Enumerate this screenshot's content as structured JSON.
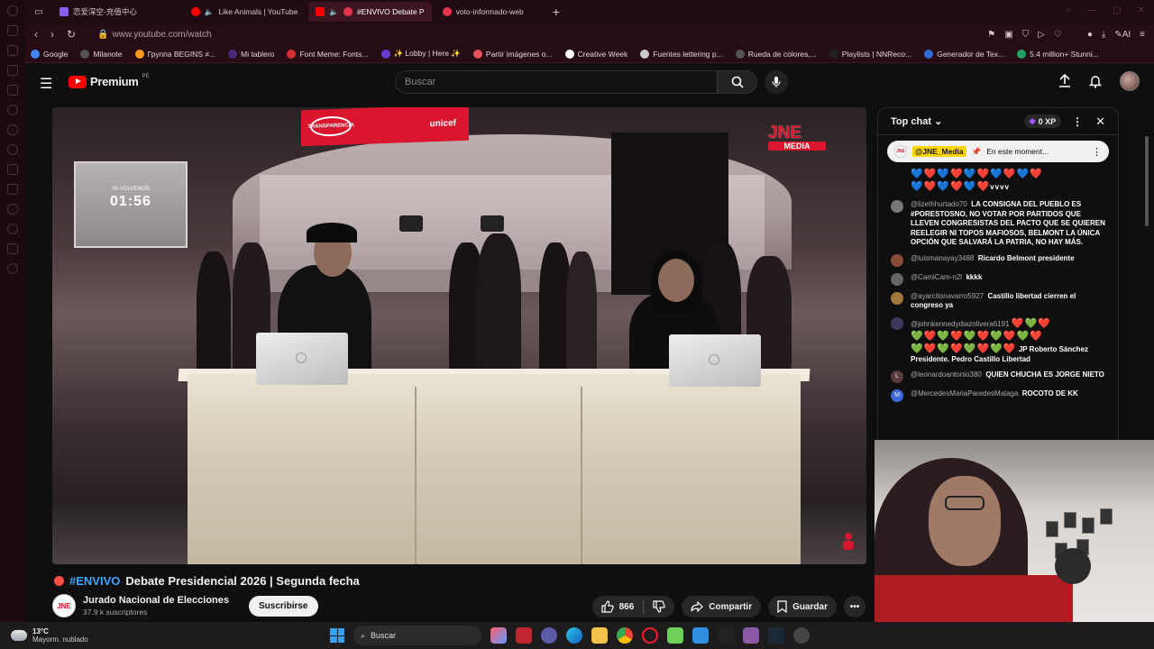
{
  "browser": {
    "tabs": [
      {
        "label": "恋爱深空-充值中心",
        "active": false,
        "color": "#8a5cf6"
      },
      {
        "label": "Like Animals | YouTube",
        "active": false,
        "color": "#ff0000"
      },
      {
        "label": "#ENVIVO Debate P",
        "active": true,
        "color": "#ff0000"
      },
      {
        "label": "voto-informado-web",
        "active": false,
        "color": "#e2354b"
      }
    ],
    "url": "www.youtube.com/watch",
    "bookmarks": [
      {
        "label": "Google",
        "color": "#4285f4"
      },
      {
        "label": "Milanote",
        "color": "#333333"
      },
      {
        "label": "Группа BEGINS ≠...",
        "color": "#f79a1e"
      },
      {
        "label": "Mi tablero",
        "color": "#4b2a7a"
      },
      {
        "label": "Font Meme: Fonts...",
        "color": "#d42e2e"
      },
      {
        "label": "✨ Lobby | Here ✨",
        "color": "#6a3bd1"
      },
      {
        "label": "Partir imágenes o...",
        "color": "#e8525c"
      },
      {
        "label": "Creative Week",
        "color": "#ffffff"
      },
      {
        "label": "Fuentes lettering p...",
        "color": "#cccccc"
      },
      {
        "label": "Rueda de colores,...",
        "color": "#555555"
      },
      {
        "label": "Playlists | NNReco...",
        "color": "#222222"
      },
      {
        "label": "Generador de Tex...",
        "color": "#2f6ad9"
      },
      {
        "label": "5.4 million+ Stunni...",
        "color": "#1fa463"
      }
    ]
  },
  "youtube": {
    "brand": "Premium",
    "country": "PE",
    "search_placeholder": "Buscar",
    "video": {
      "screen_label": "YA VOLVEMOS",
      "countdown": "01:56",
      "banner_text": "unicef",
      "banner_sub": "TRANSPARENCIA",
      "jne_top": "JNE",
      "jne_bottom": "MEDIA"
    },
    "title_tag": "#ENVIVO",
    "title_rest": "Debate Presidencial 2026 | Segunda fecha",
    "channel_name": "Jurado Nacional de Elecciones",
    "channel_avatar": "JNE",
    "subscribers": "37.9 k suscriptores",
    "subscribe_label": "Suscribirse",
    "likes": "866",
    "share_label": "Compartir",
    "save_label": "Guardar"
  },
  "chat": {
    "header": "Top chat",
    "xp": "0 XP",
    "pinned_author": "@JNE_Media",
    "pinned_text": "En este moment...",
    "messages": [
      {
        "user": "",
        "hearts": "💙❤️💙❤️💙❤️💙❤️💙❤️",
        "hearts2": "💙❤️💙❤️💙❤️",
        "text": "vvvv",
        "avatar": "#000000"
      },
      {
        "user": "@lizethhurtado70",
        "text": "LA CONSIGNA DEL PUEBLO ES #PORESTOSNO, NO VOTAR POR PARTIDOS QUE LLEVEN CONGRESISTAS DEL PACTO QUE SE QUIEREN REELEGIR NI TOPOS MAFIOSOS, BELMONT LA ÚNICA OPCIÓN QUE SALVARÁ LA PATRIA, NO HAY MÁS.",
        "avatar": "#777777"
      },
      {
        "user": "@luismanayay3488",
        "text": "Ricardo Belmont presidente",
        "avatar": "#8a4b3a"
      },
      {
        "user": "@CamiCam-n2l",
        "text": "kkkk",
        "avatar": "#666666"
      },
      {
        "user": "@ayarcitonavarro5927",
        "text": "Castillo libertad cierren el congreso ya",
        "avatar": "#a0783c"
      },
      {
        "user": "@johnkennedydiazolivera6191",
        "hearts": "❤️💚❤️",
        "hearts2": "💚❤️💚❤️💚❤️💚❤️💚❤️",
        "hearts3": "💚❤️💚❤️💚❤️💚❤️",
        "text": "JP Roberto Sánchez Presidente. Pedro Castillo Libertad",
        "avatar": "#3a3a5a"
      },
      {
        "user": "@leonardoantonio380",
        "text": "QUIEN CHUCHA ES JORGE NIETO",
        "avatar": "#5a3a3a",
        "initial": "L"
      },
      {
        "user": "@MercedesMariaParedesMalaga",
        "text": "ROCOTO DE KK",
        "avatar": "#3a6ad9",
        "initial": "M"
      }
    ]
  },
  "taskbar": {
    "temp": "13°C",
    "weather": "Mayorm. nublado",
    "search_label": "Buscar"
  }
}
